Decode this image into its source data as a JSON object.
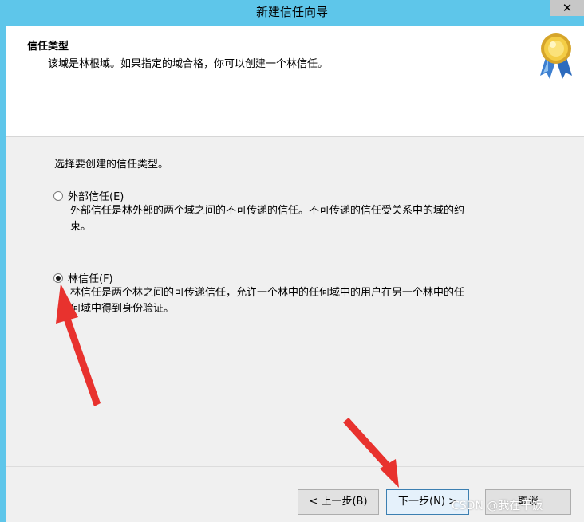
{
  "window": {
    "title": "新建信任向导",
    "close_glyph": "✕"
  },
  "header": {
    "title": "信任类型",
    "description": "该域是林根域。如果指定的域合格，你可以创建一个林信任。"
  },
  "body": {
    "prompt": "选择要创建的信任类型。",
    "options": [
      {
        "label": "外部信任(E)",
        "description_line1": "外部信任是林外部的两个域之间的不可传递的信任。不可传递的信任受关系中的域的约",
        "description_line2": "束。",
        "selected": false
      },
      {
        "label": "林信任(F)",
        "description_line1": "林信任是两个林之间的可传递信任，允许一个林中的任何域中的用户在另一个林中的任",
        "description_line2": "何域中得到身份验证。",
        "selected": true
      }
    ]
  },
  "footer": {
    "back_label": "< 上一步(B)",
    "next_label": "下一步(N) >",
    "cancel_label": "取消"
  },
  "watermark": "CSDN @我在干饭",
  "colors": {
    "titlebar": "#5ec6ea",
    "annotation_arrow": "#e8322e"
  },
  "icons": {
    "header": "award-medal-icon"
  }
}
